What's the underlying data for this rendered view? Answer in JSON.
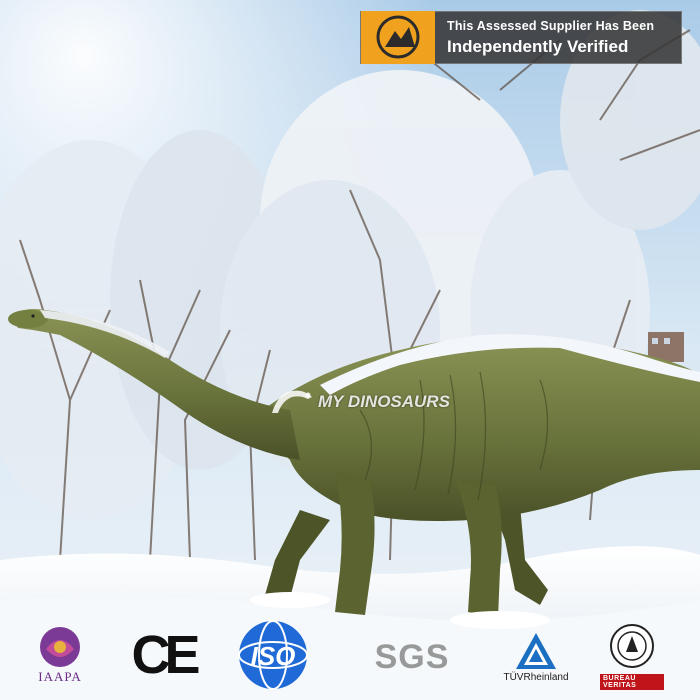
{
  "badge": {
    "line1": "This Assessed Supplier Has Been",
    "line2": "Independently Verified",
    "icon": "verified-supplier-icon"
  },
  "watermark": {
    "text": "MY DINOSAURS",
    "icon": "dinosaur-logo-icon"
  },
  "certifications": {
    "iaapa": {
      "label": "IAAPA",
      "icon": "iaapa-logo-icon"
    },
    "ce": {
      "label": "CE",
      "icon": "ce-mark-icon"
    },
    "iso": {
      "label": "ISO",
      "icon": "iso-logo-icon"
    },
    "sgs": {
      "label": "SGS",
      "icon": "sgs-logo-icon"
    },
    "tuv": {
      "label": "TÜVRheinland",
      "icon": "tuv-logo-icon"
    },
    "bureau": {
      "label": "BUREAU VERITAS",
      "icon": "bureau-veritas-icon"
    }
  },
  "colors": {
    "sky": "#cfe3f3",
    "snow": "#f4f7fb",
    "dinosaur": "#6f7a3a",
    "badge_bg": "#373737",
    "badge_accent": "#f0a21e"
  }
}
